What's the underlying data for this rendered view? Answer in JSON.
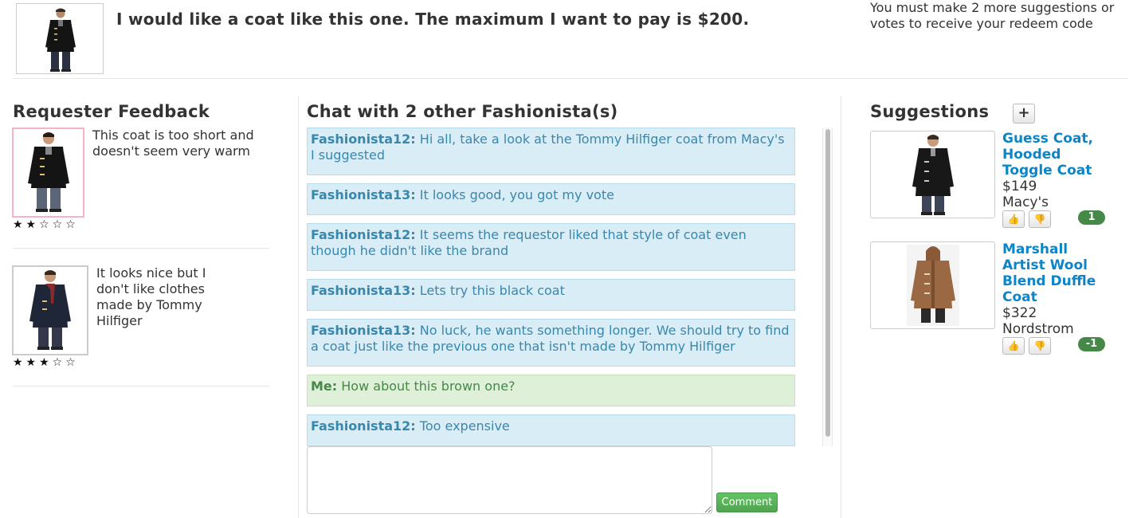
{
  "header": {
    "request_text": "I would like a coat like this one. The maximum I want to pay is $200.",
    "redeem_notice": "You must make 2 more suggestions or votes to receive your redeem code"
  },
  "feedback": {
    "title": "Requester Feedback",
    "items": [
      {
        "text": "This coat is too short and doesn't seem very warm",
        "stars": "★★☆☆☆",
        "rating": 2
      },
      {
        "text": "It looks nice but I don't like clothes made by Tommy Hilfiger",
        "stars": "★★★☆☆",
        "rating": 3
      }
    ]
  },
  "chat": {
    "title": "Chat with 2 other Fashionista(s)",
    "messages": [
      {
        "author": "Fashionista12:",
        "text": "Hi all, take a look at the Tommy Hilfiger coat from Macy's I suggested"
      },
      {
        "author": "Fashionista13:",
        "text": "It looks good, you got my vote"
      },
      {
        "author": "Fashionista12:",
        "text": "It seems the requestor liked that style of coat even though he didn't like the brand"
      },
      {
        "author": "Fashionista13:",
        "text": "Lets try this black coat"
      },
      {
        "author": "Fashionista13:",
        "text": "No luck, he wants something longer. We should try to find a coat just like the previous one that isn't made by Tommy Hilfiger"
      },
      {
        "author": "Me:",
        "text": "How about this brown one?"
      },
      {
        "author": "Fashionista12:",
        "text": "Too expensive"
      }
    ],
    "comment_value": "",
    "comment_button": "Comment"
  },
  "suggestions": {
    "title": "Suggestions",
    "add_label": "+",
    "items": [
      {
        "title": "Guess Coat, Hooded Toggle Coat",
        "price": "$149",
        "store": "Macy's",
        "votes": "1"
      },
      {
        "title": "Marshall Artist Wool Blend Duffle Coat",
        "price": "$322",
        "store": "Nordstrom",
        "votes": "-1"
      }
    ],
    "upvote_icon": "👍",
    "downvote_icon": "👎"
  },
  "colors": {
    "chat_other_bg": "#d9edf7",
    "chat_other_text": "#3a87ad",
    "chat_me_bg": "#dff0d8",
    "chat_me_text": "#468847",
    "link": "#0b85c8",
    "vote_badge": "#468847",
    "comment_button": "#5cb85c"
  }
}
